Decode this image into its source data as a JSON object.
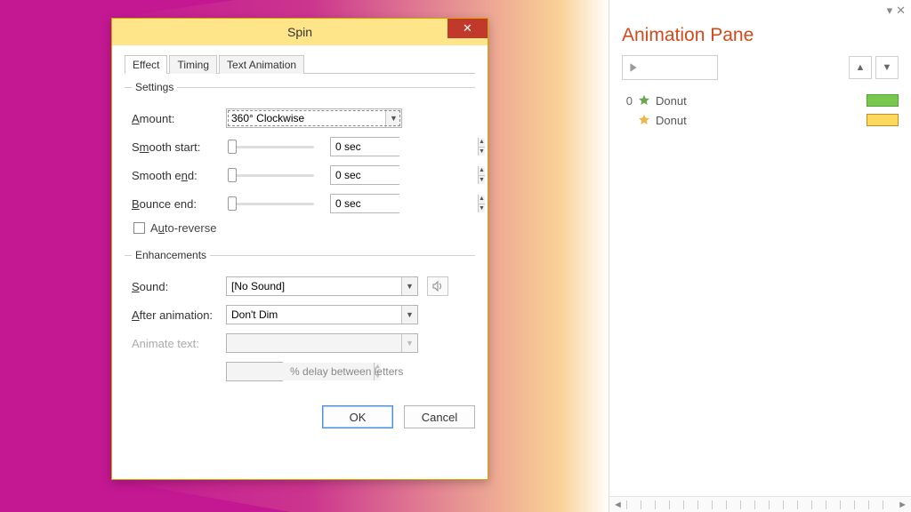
{
  "dialog": {
    "title": "Spin",
    "tabs": [
      "Effect",
      "Timing",
      "Text Animation"
    ],
    "settings_legend": "Settings",
    "amount_label": "Amount:",
    "amount_value": "360° Clockwise",
    "smooth_start_label": "Smooth start:",
    "smooth_start_value": "0 sec",
    "smooth_end_label": "Smooth end:",
    "smooth_end_value": "0 sec",
    "bounce_end_label": "Bounce end:",
    "bounce_end_value": "0 sec",
    "auto_reverse_label": "Auto-reverse",
    "enhancements_legend": "Enhancements",
    "sound_label": "Sound:",
    "sound_value": "[No Sound]",
    "after_label": "After animation:",
    "after_value": "Don't Dim",
    "animate_text_label": "Animate text:",
    "animate_text_value": "",
    "delay_value": "",
    "delay_hint": "% delay between letters",
    "ok_label": "OK",
    "cancel_label": "Cancel"
  },
  "pane": {
    "title": "Animation Pane",
    "items": [
      {
        "index": "0",
        "name": "Donut",
        "star": "#6aa84f",
        "color": "green"
      },
      {
        "index": "",
        "name": "Donut",
        "star": "#f1b64a",
        "color": "yellow"
      }
    ]
  }
}
